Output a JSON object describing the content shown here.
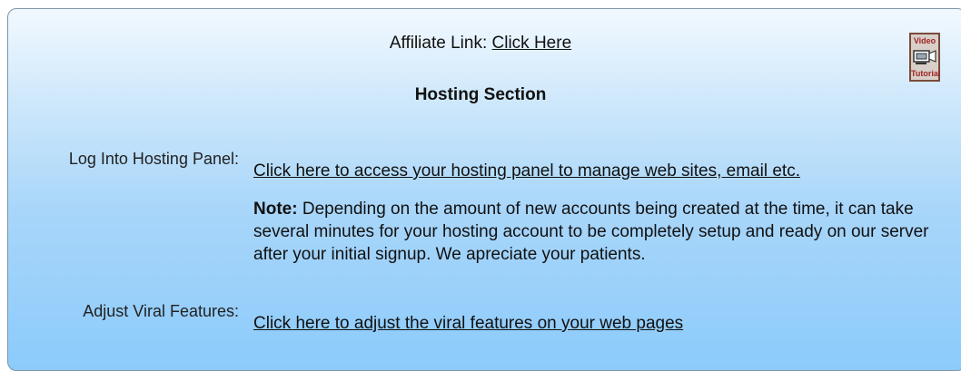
{
  "affiliate": {
    "label": "Affiliate Link:",
    "link_text": "Click Here"
  },
  "section_title": "Hosting Section",
  "video_tutorial": {
    "icon": "video-camera-icon",
    "top_text": "Video",
    "bottom_text": "Tutorial"
  },
  "hosting": {
    "label": "Log Into Hosting Panel:",
    "link_text": "Click here to access your hosting panel to manage web sites, email etc."
  },
  "note": {
    "label": "Note:",
    "text": "Depending on the amount of new accounts being created at the time, it can take several minutes for your hosting account to be completely setup and ready on our server after your initial signup. We apreciate your patients."
  },
  "viral": {
    "label": "Adjust Viral Features:",
    "link_text": "Click here to adjust the viral features on your web pages"
  },
  "colors": {
    "panel_top": "#f2f9ff",
    "panel_bottom": "#8ccbfb",
    "border": "#7f96aa"
  }
}
